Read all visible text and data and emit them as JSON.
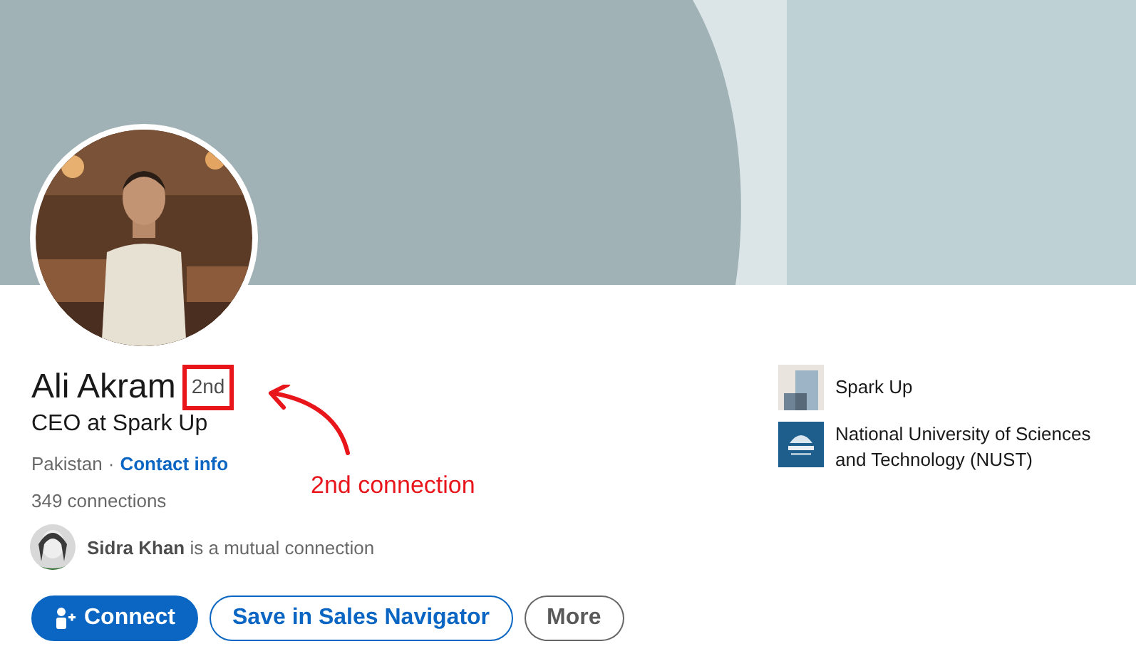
{
  "profile": {
    "name": "Ali Akram",
    "degree": "2nd",
    "headline": "CEO at Spark Up",
    "location": "Pakistan",
    "separator": "·",
    "contact_link": "Contact info",
    "connections": "349 connections",
    "mutual": "**Sidra Khan** is a mutual connection"
  },
  "organizations": [
    {
      "name": "Spark Up",
      "kind": "company"
    },
    {
      "name": "National University of Sciences and Technology (NUST)",
      "kind": "school"
    }
  ],
  "actions": [
    {
      "label": "Connect",
      "kind": "primary"
    },
    {
      "label": "Save in Sales Navigator",
      "kind": "secondary"
    },
    {
      "label": "More",
      "kind": "muted"
    }
  ],
  "annotation": {
    "text": "2nd connection"
  }
}
